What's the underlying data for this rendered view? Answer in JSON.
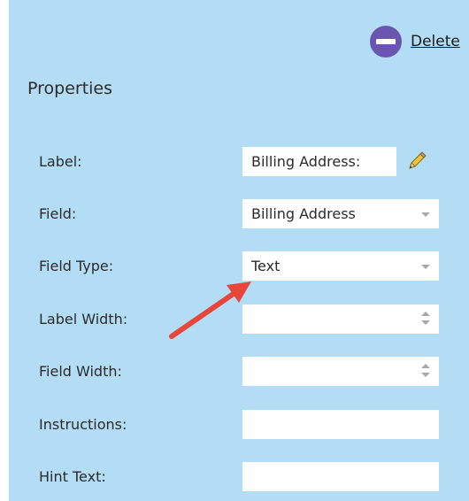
{
  "toolbar": {
    "delete_label": "Delete",
    "delete_icon": "minus-circle-icon"
  },
  "properties": {
    "title": "Properties",
    "label": {
      "name": "Label:",
      "value": "Billing Address:"
    },
    "field": {
      "name": "Field:",
      "value": "Billing Address"
    },
    "field_type": {
      "name": "Field Type:",
      "value": "Text"
    },
    "label_width": {
      "name": "Label Width:",
      "value": ""
    },
    "field_width": {
      "name": "Field Width:",
      "value": ""
    },
    "instructions": {
      "name": "Instructions:",
      "value": ""
    },
    "hint_text": {
      "name": "Hint Text:",
      "value": ""
    }
  },
  "colors": {
    "panel_bg": "#b3ddf4",
    "delete_icon": "#6a55b0",
    "arrow": "#e8453c",
    "pencil": "#f2c230"
  }
}
